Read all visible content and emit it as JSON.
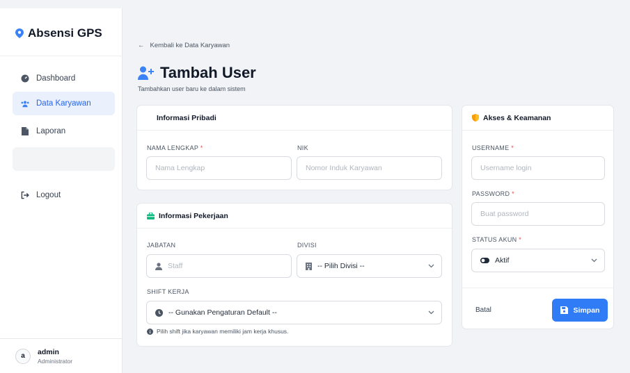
{
  "sidebar": {
    "brand": "Absensi GPS",
    "items": [
      {
        "label": "Dashboard",
        "icon": "dashboard-icon"
      },
      {
        "label": "Data Karyawan",
        "icon": "users-icon"
      },
      {
        "label": "Laporan",
        "icon": "file-icon"
      },
      {
        "label": "Logout",
        "icon": "logout-icon"
      }
    ],
    "user": {
      "initial": "a",
      "name": "admin",
      "role": "Administrator"
    }
  },
  "header": {
    "back_label": "Kembali ke Data Karyawan",
    "title": "Tambah User",
    "subtitle": "Tambahkan user baru ke dalam sistem"
  },
  "pribadi": {
    "heading": "Informasi Pribadi",
    "nama_label": "NAMA LENGKAP",
    "nama_placeholder": "Nama Lengkap",
    "nik_label": "NIK",
    "nik_placeholder": "Nomor Induk Karyawan"
  },
  "pekerjaan": {
    "heading": "Informasi Pekerjaan",
    "jabatan_label": "JABATAN",
    "jabatan_placeholder": "Staff",
    "divisi_label": "DIVISI",
    "divisi_value": "-- Pilih Divisi --",
    "shift_label": "SHIFT KERJA",
    "shift_value": "-- Gunakan Pengaturan Default --",
    "shift_hint": "Pilih shift jika karyawan memiliki jam kerja khusus."
  },
  "akses": {
    "heading": "Akses & Keamanan",
    "username_label": "USERNAME",
    "username_placeholder": "Username login",
    "password_label": "PASSWORD",
    "password_placeholder": "Buat password",
    "status_label": "STATUS AKUN",
    "status_value": "Aktif",
    "cancel_label": "Batal",
    "save_label": "Simpan"
  },
  "required_mark": "*",
  "colors": {
    "accent": "#2f7cf6",
    "active_bg": "#eaf1fd",
    "pin": "#3b82f6",
    "shield": "#f59e0b",
    "briefcase": "#10b981"
  }
}
